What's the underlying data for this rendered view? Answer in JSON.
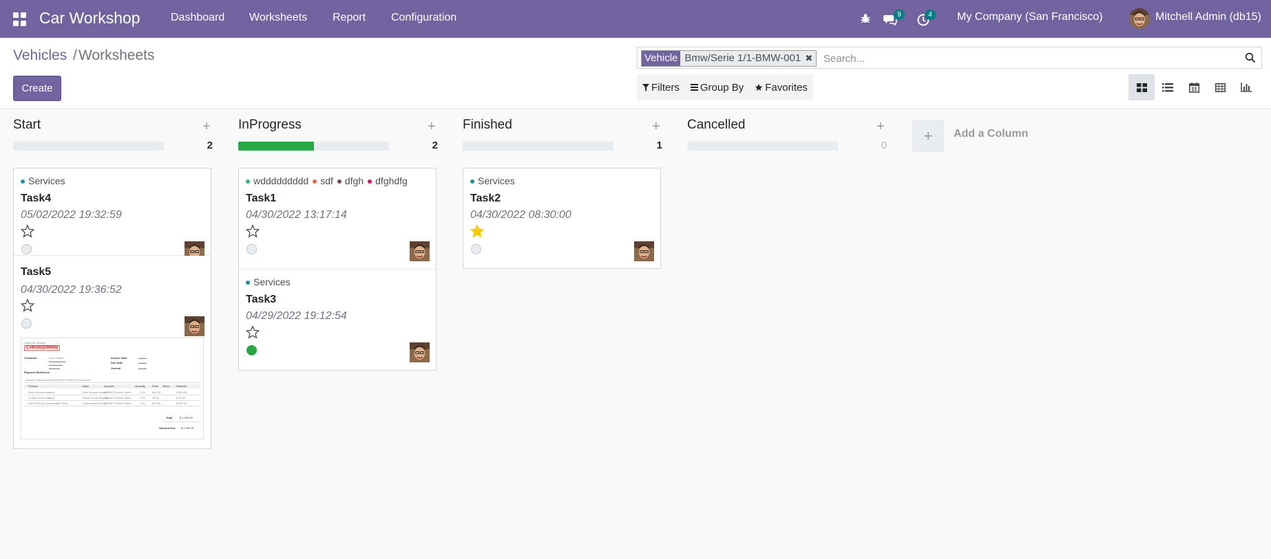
{
  "navbar": {
    "app_title": "Car Workshop",
    "menu": [
      "Dashboard",
      "Worksheets",
      "Report",
      "Configuration"
    ],
    "messages_count": "9",
    "activities_count": "4",
    "company": "My Company (San Francisco)",
    "user": "Mitchell Admin (db15)",
    "icons": [
      "apps-grid-icon",
      "bug-icon",
      "chat-icon",
      "clock-icon"
    ]
  },
  "breadcrumb": {
    "root": "Vehicles",
    "separator": "/",
    "current": "Worksheets"
  },
  "create_label": "Create",
  "search": {
    "facet_label": "Vehicle",
    "facet_value": "Bmw/Serie 1/1-BMW-001",
    "placeholder": "Search..."
  },
  "filters": {
    "filters_label": "Filters",
    "groupby_label": "Group By",
    "favorites_label": "Favorites"
  },
  "views": [
    "kanban",
    "list",
    "calendar",
    "pivot",
    "graph"
  ],
  "columns": [
    {
      "title": "Start",
      "count": "2",
      "progress": 0,
      "cards": [
        {
          "tags": [
            {
              "label": "Services",
              "color": "#1f8fa0"
            }
          ],
          "title": "Task4",
          "date": "05/02/2022 19:32:59",
          "starred": false,
          "state": "normal"
        },
        {
          "tags": [],
          "title": "Task5",
          "date": "04/30/2022 19:36:52",
          "starred": false,
          "state": "normal",
          "attachment": {
            "header": "Customer Invoice",
            "number": "CAR/2022/00002",
            "customer_label": "Customer",
            "customer": "Deco Addict",
            "invoice_date_label": "Invoice Date",
            "due_date_label": "Due Date",
            "journal_label": "Journal",
            "payment_ref_label": "Payment Reference",
            "tabs": [
              "Invoice Lines",
              "Journal Items",
              "Other Info",
              "EDI Documents"
            ],
            "table_headers": [
              "Product",
              "Label",
              "Account",
              "Quantity",
              "Price",
              "Taxes",
              "Subtotal"
            ],
            "rows": [
              [
                "Desk Accommodation",
                "Desk Accommodation",
                "400000 Product Sales",
                "1.00",
                "600.00",
                "",
                "$ 600.00"
              ],
              [
                "Virtual Home Staging",
                "Virtual Home Staging",
                "400000 Product Sales",
                "1.00",
                "30.00",
                "",
                "$ 30.00"
              ],
              [
                "[DESK0004] Customizable Desk",
                "Customizable Desk",
                "400000 Product Sales",
                "1.00",
                "800.40",
                "",
                "$ 800.40"
              ]
            ],
            "total_label": "Total",
            "total": "$ 1,250.00",
            "amount_due_label": "Amount Due",
            "amount_due": "$ 1,250.00"
          }
        }
      ]
    },
    {
      "title": "InProgress",
      "count": "2",
      "progress": 0.5,
      "cards": [
        {
          "tags": [
            {
              "label": "wddddddddd",
              "color": "#2eb67d"
            },
            {
              "label": "sdf",
              "color": "#f06050"
            },
            {
              "label": "dfgh",
              "color": "#6c4a5a"
            },
            {
              "label": "dfghdfg",
              "color": "#d6145f"
            }
          ],
          "title": "Task1",
          "date": "04/30/2022 13:17:14",
          "starred": false,
          "state": "normal"
        },
        {
          "tags": [
            {
              "label": "Services",
              "color": "#1f8fa0"
            }
          ],
          "title": "Task3",
          "date": "04/29/2022 19:12:54",
          "starred": false,
          "state": "done"
        }
      ]
    },
    {
      "title": "Finished",
      "count": "1",
      "progress": 0,
      "cards": [
        {
          "tags": [
            {
              "label": "Services",
              "color": "#1f8fa0"
            }
          ],
          "title": "Task2",
          "date": "04/30/2022 08:30:00",
          "starred": true,
          "state": "normal"
        }
      ]
    },
    {
      "title": "Cancelled",
      "count": "0",
      "progress": 0,
      "cards": []
    }
  ],
  "add_column_label": "Add a Column",
  "colors": {
    "brand": "#71639e",
    "progress": "#28a745",
    "star": "#f3cc00",
    "badge": "#017e84"
  }
}
